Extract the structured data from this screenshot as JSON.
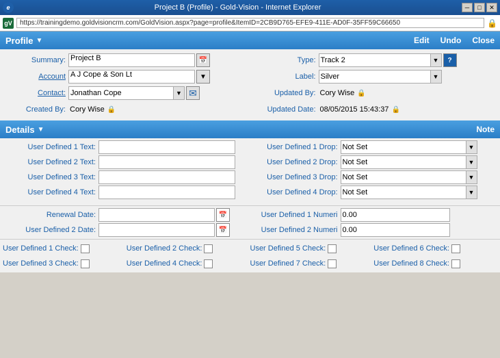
{
  "window": {
    "title": "Project B (Profile) - Gold-Vision - Internet Explorer",
    "url": "https://trainingdemo.goldvisioncrm.com/GoldVision.aspx?page=profile&ItemID=2CB9D765-EFE9-411E-AD0F-35FF59C66650"
  },
  "title_controls": {
    "minimize": "─",
    "maximize": "□",
    "close": "✕"
  },
  "profile_section": {
    "title": "Profile",
    "actions": {
      "edit": "Edit",
      "undo": "Undo",
      "close": "Close"
    },
    "fields": {
      "summary_label": "Summary:",
      "summary_value": "Project B",
      "type_label": "Type:",
      "type_value": "Track 2",
      "account_label": "Account",
      "account_value": "A J Cope & Son Lt",
      "label_label": "Label:",
      "label_value": "Silver",
      "contact_label": "Contact:",
      "contact_value": "Jonathan Cope",
      "updated_by_label": "Updated By:",
      "updated_by_value": "Cory Wise",
      "created_by_label": "Created By:",
      "created_by_value": "Cory Wise",
      "updated_date_label": "Updated Date:",
      "updated_date_value": "08/05/2015 15:43:37"
    }
  },
  "details_section": {
    "title": "Details",
    "note_label": "Note",
    "text_fields": [
      {
        "label": "User Defined 1 Text:",
        "value": ""
      },
      {
        "label": "User Defined 2 Text:",
        "value": ""
      },
      {
        "label": "User Defined 3 Text:",
        "value": ""
      },
      {
        "label": "User Defined 4 Text:",
        "value": ""
      }
    ],
    "drop_fields": [
      {
        "label": "User Defined 1 Drop:",
        "value": "Not Set"
      },
      {
        "label": "User Defined 2 Drop:",
        "value": "Not Set"
      },
      {
        "label": "User Defined 3 Drop:",
        "value": "Not Set"
      },
      {
        "label": "User Defined 4 Drop:",
        "value": "Not Set"
      }
    ],
    "date_fields": [
      {
        "label": "Renewal Date:",
        "value": ""
      },
      {
        "label": "User Defined 2 Date:",
        "value": ""
      }
    ],
    "numeric_fields": [
      {
        "label": "User Defined 1 Numeri",
        "value": "0.00"
      },
      {
        "label": "User Defined 2 Numeri",
        "value": "0.00"
      }
    ],
    "check_row1": [
      {
        "label": "User Defined 1 Check:"
      },
      {
        "label": "User Defined 2 Check:"
      },
      {
        "label": "User Defined 5 Check:"
      },
      {
        "label": "User Defined 6 Check:"
      }
    ],
    "check_row2": [
      {
        "label": "User Defined 3 Check:"
      },
      {
        "label": "User Defined 4 Check:"
      },
      {
        "label": "User Defined 7 Check:"
      },
      {
        "label": "User Defined 8 Check:"
      }
    ]
  }
}
